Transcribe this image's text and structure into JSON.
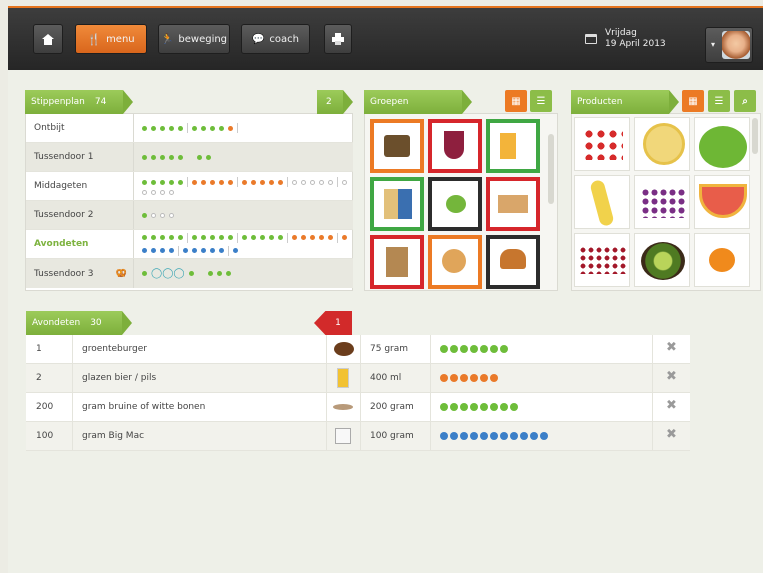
{
  "topbar": {
    "home_label": "",
    "menu_label": "menu",
    "beweging_label": "beweging",
    "coach_label": "coach",
    "date_day": "Vrijdag",
    "date_full": "19 April 2013"
  },
  "stippenplan": {
    "title": "Stippenplan",
    "total": "74",
    "badge": "2",
    "rows": [
      {
        "label": "Ontbijt"
      },
      {
        "label": "Tussendoor 1"
      },
      {
        "label": "Middageten"
      },
      {
        "label": "Tussendoor 2"
      },
      {
        "label": "Avondeten"
      },
      {
        "label": "Tussendoor 3"
      }
    ]
  },
  "groepen": {
    "title": "Groepen"
  },
  "producten": {
    "title": "Producten"
  },
  "avondeten": {
    "title": "Avondeten",
    "total": "30",
    "badge": "1",
    "items": [
      {
        "qty": "1",
        "name": "groenteburger",
        "amount": "75 gram",
        "dots": 7,
        "color": "#6ebd3a"
      },
      {
        "qty": "2",
        "name": "glazen bier / pils",
        "amount": "400 ml",
        "dots": 6,
        "color": "#ea7a2a"
      },
      {
        "qty": "200",
        "name": "gram bruine of witte bonen",
        "amount": "200 gram",
        "dots": 8,
        "color": "#6ebd3a"
      },
      {
        "qty": "100",
        "name": "gram Big Mac",
        "amount": "100 gram",
        "dots": 11,
        "color": "#3b7fc8"
      }
    ]
  }
}
